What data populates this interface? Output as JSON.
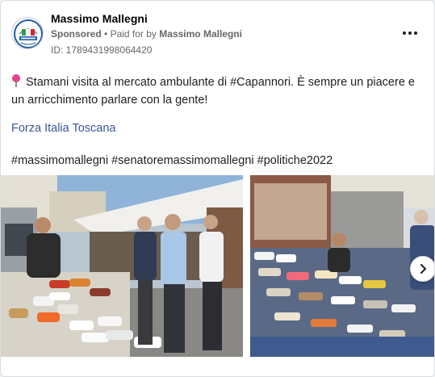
{
  "advertiser": {
    "name": "Massimo Mallegni",
    "sponsored_label": "Sponsored",
    "separator": "•",
    "paid_for_prefix": "Paid for by",
    "paid_for_name": "Massimo Mallegni",
    "id_label": "ID: 1789431998064420",
    "avatar_icon": "forza-italia-logo"
  },
  "post": {
    "text": "Stamani visita al mercato ambulante di #Capannori. È sempre un piacere e un arricchimento parlare con la gente!",
    "link_text": "Forza Italia Toscana",
    "hashtags": "#massimomallegni #senatoremassimomallegni #politiche2022"
  },
  "icons": {
    "pin": "round-pushpin-icon",
    "more": "more-horizontal-icon",
    "next": "chevron-right-icon"
  },
  "colors": {
    "link": "#385898",
    "secondary_text": "#65676b",
    "pin": "#e5418c"
  }
}
